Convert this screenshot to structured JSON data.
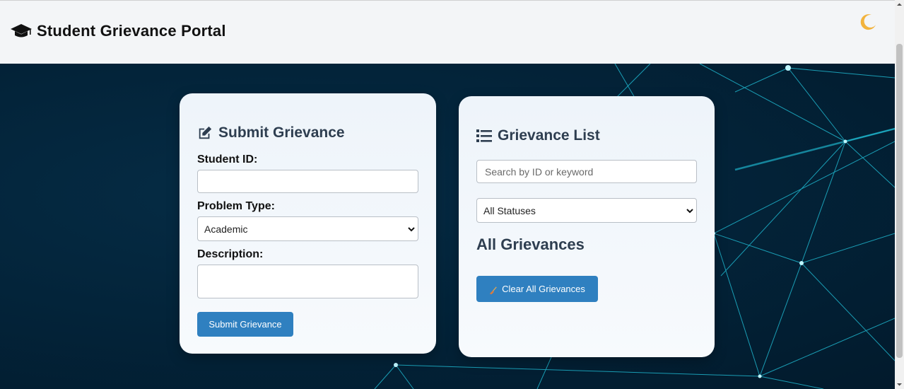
{
  "app": {
    "title": "Student Grievance Portal",
    "brand_icon": "graduation-cap-icon",
    "theme_toggle_icon": "crescent-moon-icon"
  },
  "submit_form": {
    "heading": "Submit Grievance",
    "heading_icon": "edit-icon",
    "student_id_label": "Student ID:",
    "student_id_value": "",
    "problem_type_label": "Problem Type:",
    "problem_type_selected": "Academic",
    "description_label": "Description:",
    "description_value": "",
    "submit_label": "Submit Grievance"
  },
  "grievance_list": {
    "heading": "Grievance List",
    "heading_icon": "list-icon",
    "search_placeholder": "Search by ID or keyword",
    "status_filter_selected": "All Statuses",
    "section_title": "All Grievances",
    "clear_label": "Clear All Grievances",
    "clear_icon": "broom-icon"
  },
  "colors": {
    "header_bg": "#f3f5f7",
    "card_heading": "#2e3e50",
    "button_bg": "#2f80c0",
    "hero_bg": "#03243a",
    "network_lines": "#22c8e0"
  }
}
